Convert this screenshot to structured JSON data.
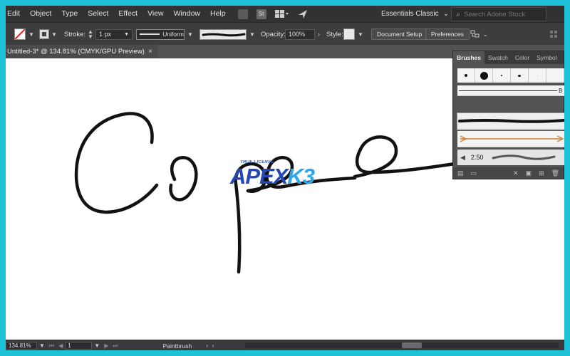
{
  "menubar": {
    "items": [
      "Edit",
      "Object",
      "Type",
      "Select",
      "Effect",
      "View",
      "Window",
      "Help"
    ],
    "stock_icon_label": "St",
    "workspace": "Essentials Classic",
    "search_placeholder": "Search Adobe Stock"
  },
  "controlbar": {
    "stroke_label": "Stroke:",
    "stroke_weight": "1 px",
    "profile": "Uniform",
    "opacity_label": "Opacity:",
    "opacity_value": "100%",
    "style_label": "Style:",
    "document_setup": "Document Setup",
    "preferences": "Preferences"
  },
  "document": {
    "tab_title": "Untitled-3* @ 134.81% (CMYK/GPU Preview)",
    "close_glyph": "×",
    "watermark_small": "TRUE LICENSE",
    "watermark_part1": "APEX",
    "watermark_part2": "K3"
  },
  "brushes_panel": {
    "tabs": [
      "Brushes",
      "Swatch",
      "Color",
      "Symbol"
    ],
    "basic_label": "B",
    "size_value": "2.50"
  },
  "statusbar": {
    "zoom": "134.81%",
    "artboard": "1",
    "tool": "Paintbrush"
  }
}
